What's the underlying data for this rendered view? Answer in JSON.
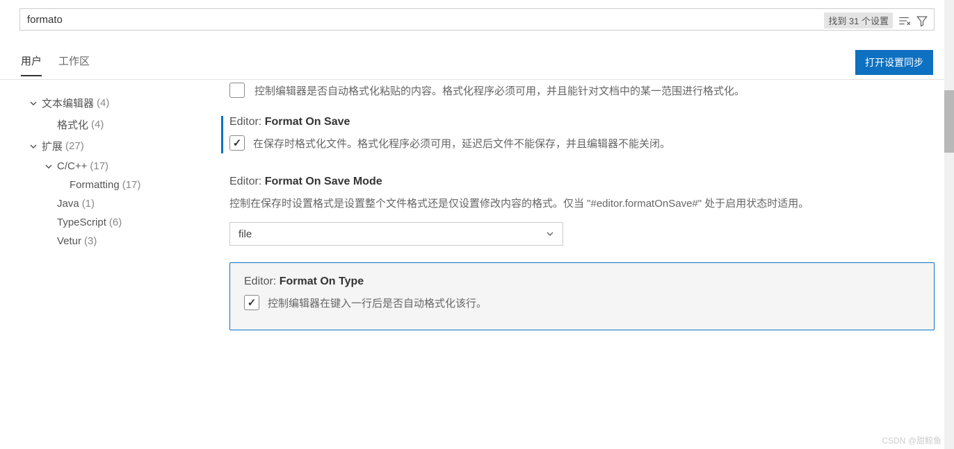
{
  "search": {
    "value": "formato",
    "result_count": "找到 31 个设置"
  },
  "tabs": {
    "user": "用户",
    "workspace": "工作区"
  },
  "sync_button": "打开设置同步",
  "sidebar": {
    "items": [
      {
        "label": "文本编辑器",
        "count": "(4)",
        "expanded": true,
        "indent": 0
      },
      {
        "label": "格式化",
        "count": "(4)",
        "expanded": null,
        "indent": 1
      },
      {
        "label": "扩展",
        "count": "(27)",
        "expanded": true,
        "indent": 0
      },
      {
        "label": "C/C++",
        "count": "(17)",
        "expanded": true,
        "indent": 1
      },
      {
        "label": "Formatting",
        "count": "(17)",
        "expanded": null,
        "indent": 2
      },
      {
        "label": "Java",
        "count": "(1)",
        "expanded": null,
        "indent": 1
      },
      {
        "label": "TypeScript",
        "count": "(6)",
        "expanded": null,
        "indent": 1
      },
      {
        "label": "Vetur",
        "count": "(3)",
        "expanded": null,
        "indent": 1
      }
    ]
  },
  "settings": {
    "partial_top": {
      "desc": "控制编辑器是否自动格式化粘贴的内容。格式化程序必须可用，并且能针对文档中的某一范围进行格式化。"
    },
    "format_on_save": {
      "prefix": "Editor: ",
      "title": "Format On Save",
      "desc": "在保存时格式化文件。格式化程序必须可用，延迟后文件不能保存，并且编辑器不能关闭。",
      "checked": true
    },
    "format_on_save_mode": {
      "prefix": "Editor: ",
      "title": "Format On Save Mode",
      "desc": "控制在保存时设置格式是设置整个文件格式还是仅设置修改内容的格式。仅当 \"#editor.formatOnSave#\" 处于启用状态时适用。",
      "value": "file"
    },
    "format_on_type": {
      "prefix": "Editor: ",
      "title": "Format On Type",
      "desc": "控制编辑器在键入一行后是否自动格式化该行。",
      "checked": true
    }
  },
  "watermark": "CSDN @甜鲸鱼"
}
